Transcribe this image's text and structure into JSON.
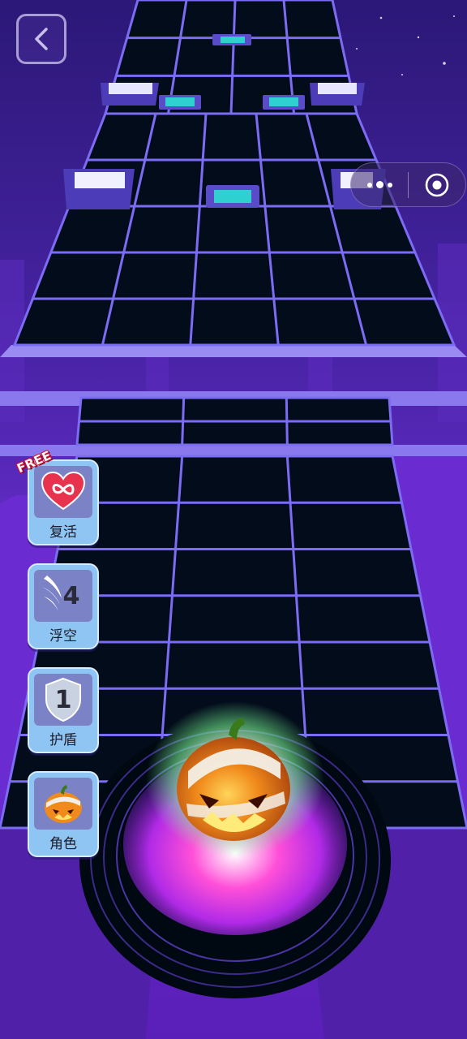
{
  "nav": {
    "back_icon": "chevron-left-icon",
    "menu_icon": "more-dots-icon",
    "close_icon": "target-circle-icon"
  },
  "powerups": [
    {
      "id": "revive",
      "label": "复活",
      "badge": "FREE",
      "icon": "infinity-heart-icon"
    },
    {
      "id": "float",
      "label": "浮空",
      "count": "4",
      "icon": "wing-icon"
    },
    {
      "id": "shield",
      "label": "护盾",
      "count": "1",
      "icon": "shield-icon"
    },
    {
      "id": "character",
      "label": "角色",
      "icon": "pumpkin-icon"
    }
  ],
  "colors": {
    "sky_top": "#2c1a7c",
    "sky_bottom": "#6a2fd0",
    "grid_line": "#7c6cf4",
    "tile": "#020c1a",
    "target_tile": "#2fd0d0"
  }
}
